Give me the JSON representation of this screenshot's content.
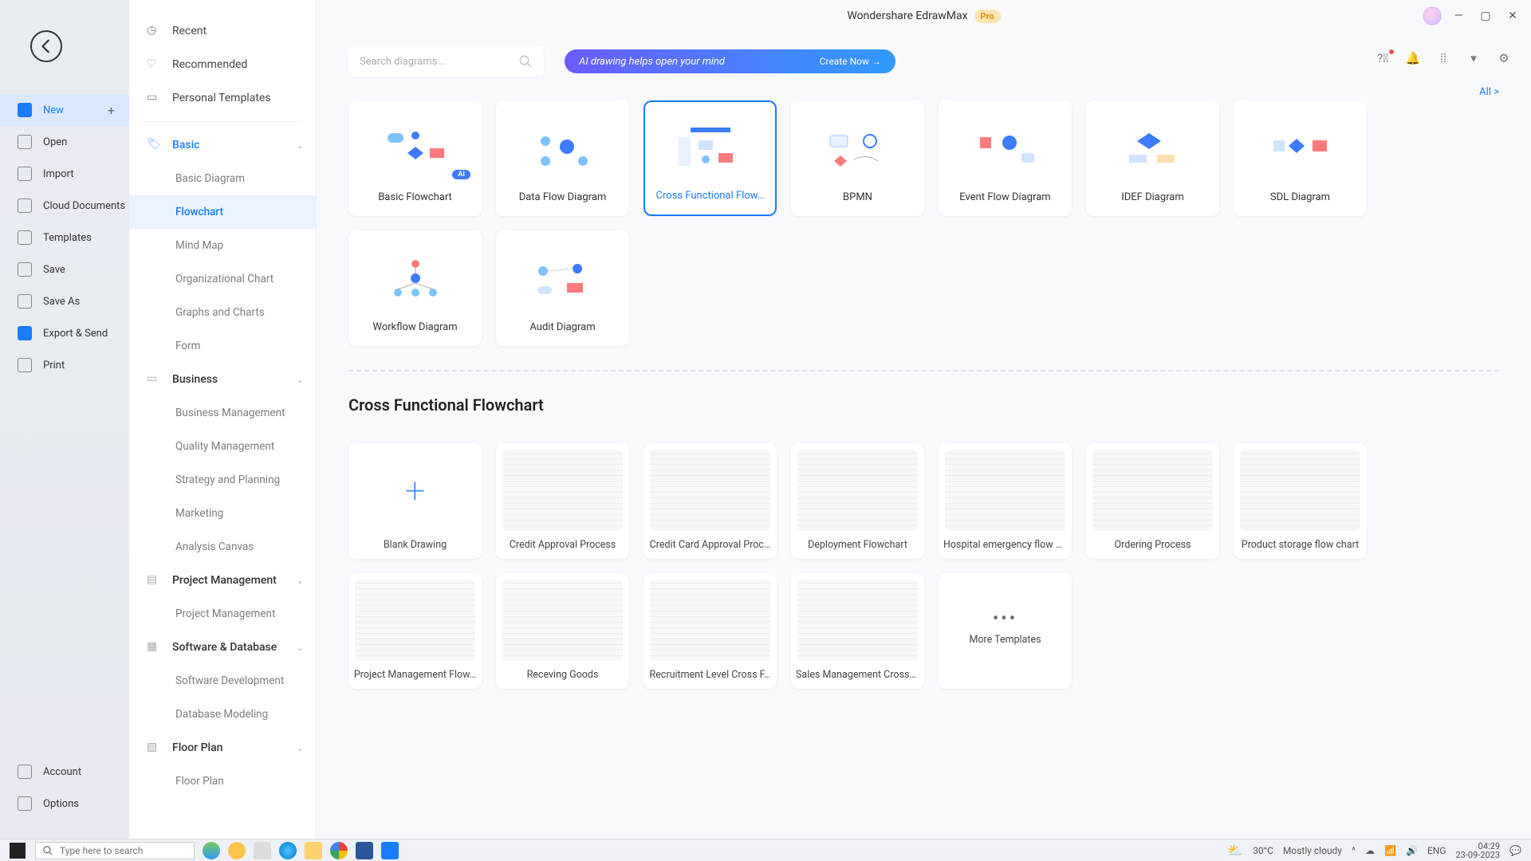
{
  "window": {
    "title": "Wondershare EdrawMax",
    "badge": "Pro"
  },
  "leftStrip": {
    "items": [
      {
        "id": "new",
        "label": "New",
        "active": true,
        "hasPlus": true
      },
      {
        "id": "open",
        "label": "Open"
      },
      {
        "id": "import",
        "label": "Import"
      },
      {
        "id": "cloud",
        "label": "Cloud Documents"
      },
      {
        "id": "templates",
        "label": "Templates"
      },
      {
        "id": "save",
        "label": "Save"
      },
      {
        "id": "saveas",
        "label": "Save As"
      },
      {
        "id": "export",
        "label": "Export & Send"
      },
      {
        "id": "print",
        "label": "Print"
      }
    ],
    "bottom": [
      {
        "id": "account",
        "label": "Account"
      },
      {
        "id": "options",
        "label": "Options"
      }
    ]
  },
  "midPanel": {
    "top": [
      {
        "id": "recent",
        "label": "Recent"
      },
      {
        "id": "recommended",
        "label": "Recommended"
      },
      {
        "id": "personal",
        "label": "Personal Templates"
      }
    ],
    "categories": [
      {
        "id": "basic",
        "label": "Basic",
        "active": true,
        "subs": [
          {
            "id": "basicdiagram",
            "label": "Basic Diagram"
          },
          {
            "id": "flowchart",
            "label": "Flowchart",
            "active": true
          },
          {
            "id": "mindmap",
            "label": "Mind Map"
          },
          {
            "id": "org",
            "label": "Organizational Chart"
          },
          {
            "id": "graphs",
            "label": "Graphs and Charts"
          },
          {
            "id": "form",
            "label": "Form"
          }
        ]
      },
      {
        "id": "business",
        "label": "Business",
        "subs": [
          {
            "id": "bm",
            "label": "Business Management"
          },
          {
            "id": "qm",
            "label": "Quality Management"
          },
          {
            "id": "sp",
            "label": "Strategy and Planning"
          },
          {
            "id": "mk",
            "label": "Marketing"
          },
          {
            "id": "ac",
            "label": "Analysis Canvas"
          }
        ]
      },
      {
        "id": "pm",
        "label": "Project Management",
        "subs": [
          {
            "id": "pm1",
            "label": "Project Management"
          }
        ]
      },
      {
        "id": "sd",
        "label": "Software & Database",
        "subs": [
          {
            "id": "sdev",
            "label": "Software Development"
          },
          {
            "id": "dbm",
            "label": "Database Modeling"
          }
        ]
      },
      {
        "id": "floor",
        "label": "Floor Plan",
        "subs": [
          {
            "id": "fp1",
            "label": "Floor Plan"
          }
        ]
      }
    ]
  },
  "search": {
    "placeholder": "Search diagrams..."
  },
  "aiBanner": {
    "text": "AI drawing helps open your mind",
    "cta": "Create Now  →"
  },
  "allLink": "All  >",
  "typeTiles": [
    {
      "id": "basicflow",
      "label": "Basic Flowchart",
      "ai": true
    },
    {
      "id": "dfd",
      "label": "Data Flow Diagram"
    },
    {
      "id": "cross",
      "label": "Cross Functional Flow…",
      "selected": true
    },
    {
      "id": "bpmn",
      "label": "BPMN"
    },
    {
      "id": "event",
      "label": "Event Flow Diagram"
    },
    {
      "id": "idef",
      "label": "IDEF Diagram"
    },
    {
      "id": "sdl",
      "label": "SDL Diagram"
    },
    {
      "id": "workflow",
      "label": "Workflow Diagram"
    },
    {
      "id": "audit",
      "label": "Audit Diagram"
    }
  ],
  "sectionTitle": "Cross Functional Flowchart",
  "templates": [
    {
      "id": "blank",
      "label": "Blank Drawing",
      "blank": true
    },
    {
      "id": "credit",
      "label": "Credit Approval Process"
    },
    {
      "id": "cc",
      "label": "Credit Card Approval Proc…"
    },
    {
      "id": "deploy",
      "label": "Deployment Flowchart"
    },
    {
      "id": "hosp",
      "label": "Hospital emergency flow c…"
    },
    {
      "id": "order",
      "label": "Ordering Process"
    },
    {
      "id": "storage",
      "label": "Product storage flow chart"
    },
    {
      "id": "pmf",
      "label": "Project Management Flow…"
    },
    {
      "id": "recv",
      "label": "Receving Goods"
    },
    {
      "id": "recruit",
      "label": "Recruitment Level Cross F…"
    },
    {
      "id": "sales",
      "label": "Sales Management Crossf…"
    },
    {
      "id": "more",
      "label": "More Templates",
      "more": true
    }
  ],
  "taskbar": {
    "search": "Type here to search",
    "weatherTemp": "30°C",
    "weatherDesc": "Mostly cloudy",
    "time": "04:29",
    "date": "23-09-2023"
  }
}
